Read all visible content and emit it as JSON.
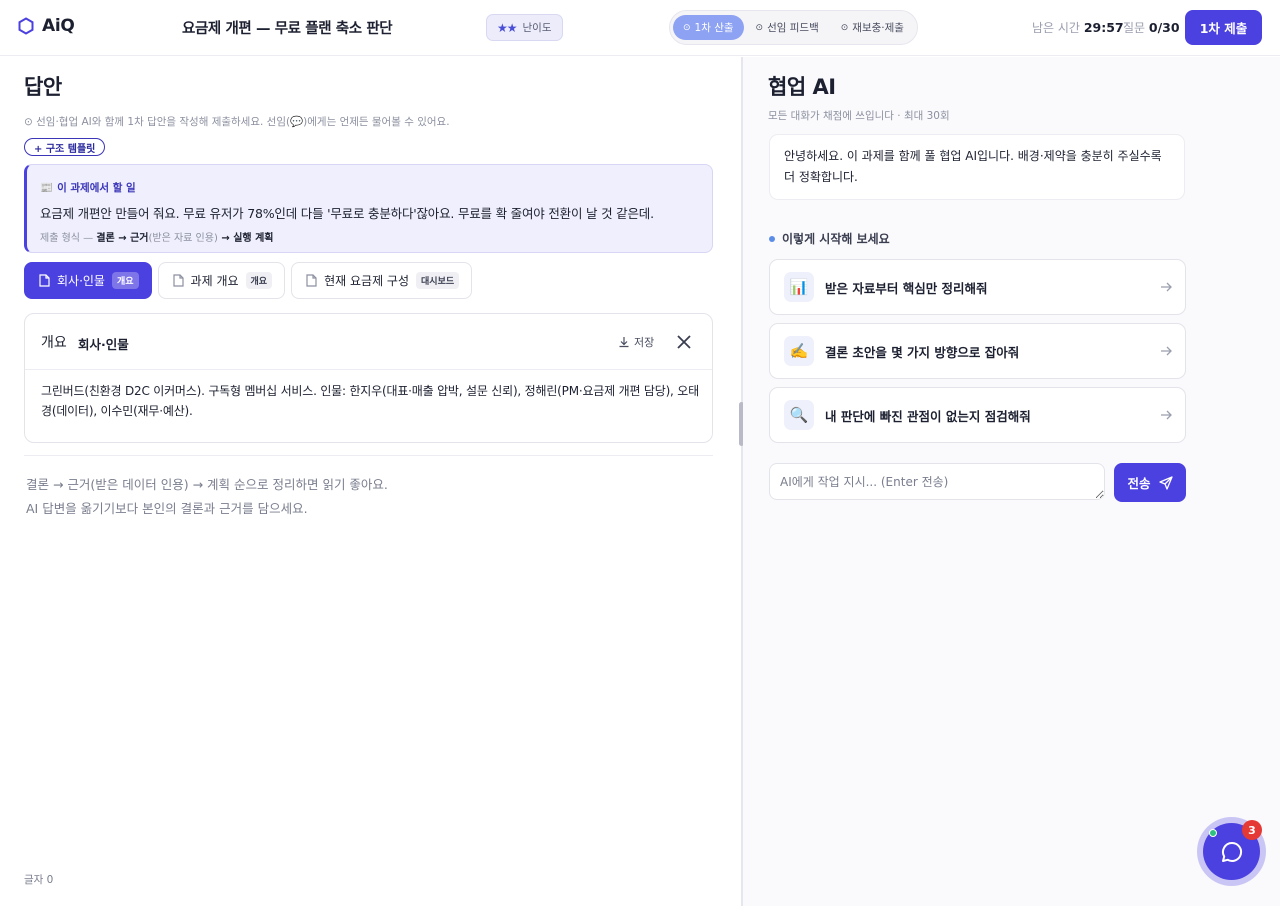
{
  "header": {
    "logo": "AiQ",
    "task_title": "요금제 개편 — 무료 플랜 축소 판단",
    "difficulty_stars": "★★",
    "difficulty_label": "난이도",
    "steps": [
      {
        "icon": "⊙",
        "label": "1차 산출",
        "active": true
      },
      {
        "icon": "⊙",
        "label": "선임 피드백",
        "active": false
      },
      {
        "icon": "⊙",
        "label": "재보충·제출",
        "active": false
      }
    ],
    "timer_label": "남은 시간",
    "timer_value": "29:57",
    "question_label": "질문",
    "question_value": "0/30",
    "submit_label": "1차 제출"
  },
  "answer": {
    "title": "답안",
    "hint": "⊙ 선임·협업 AI와 함께 1차 답안을 작성해 제출하세요. 선임(💬)에게는 언제든 물어볼 수 있어요.",
    "template_button": "+ 구조 템플릿",
    "mission": {
      "icon": "📰",
      "heading": "이 과제에서 할 일",
      "body": "요금제 개편안 만들어 줘요. 무료 유저가 78%인데 다들 '무료로 충분하다'잖아요. 무료를 확 줄여야 전환이 날 것 같은데.",
      "format_prefix": "제출 형식 — ",
      "format_1": "결론",
      "arrow": " → ",
      "format_2": "근거",
      "format_2_note": "(받은 자료 인용)",
      "format_3": "실행 계획"
    },
    "doc_tabs": [
      {
        "label": "회사·인물",
        "tag": "개요",
        "active": true
      },
      {
        "label": "과제 개요",
        "tag": "개요",
        "active": false
      },
      {
        "label": "현재 요금제 구성",
        "tag": "대시보드",
        "active": false
      }
    ],
    "doc": {
      "kind": "개요",
      "name": "회사·인물",
      "save_label": "저장",
      "body": "그린버드(친환경 D2C 이커머스). 구독형 멤버십 서비스. 인물: 한지우(대표·매출 압박, 설문 신뢰), 정해린(PM·요금제 개편 담당), 오태경(데이터), 이수민(재무·예산)."
    },
    "editor_placeholder_1": "결론 → 근거(받은 데이터 인용) → 계획 순으로 정리하면 읽기 좋아요.",
    "editor_placeholder_2": "AI 답변을 옮기기보다 본인의 결론과 근거를 담으세요.",
    "char_count": "글자 0"
  },
  "ai": {
    "title": "협업 AI",
    "subtitle": "모든 대화가 채점에 쓰입니다 · 최대 30회",
    "greeting": "안녕하세요. 이 과제를 함께 풀 협업 AI입니다. 배경·제약을 충분히 주실수록 더 정확합니다.",
    "start_title": "이렇게 시작해 보세요",
    "suggestions": [
      {
        "icon": "📊",
        "icon_name": "chart-icon",
        "label": "받은 자료부터 핵심만 정리해줘"
      },
      {
        "icon": "✍️",
        "icon_name": "writing-hand-icon",
        "label": "결론 초안을 몇 가지 방향으로 잡아줘"
      },
      {
        "icon": "🔍",
        "icon_name": "magnifier-icon",
        "label": "내 판단에 빠진 관점이 없는지 점검해줘"
      }
    ],
    "input_placeholder": "AI에게 작업 지시... (Enter 전송)",
    "send_label": "전송"
  },
  "chat_fab": {
    "badge": "3"
  },
  "colors": {
    "accent": "#4b40e0",
    "accent_soft": "#efeffd",
    "step_active": "#8da2f2",
    "badge": "#e53935",
    "online": "#2ec27e"
  }
}
